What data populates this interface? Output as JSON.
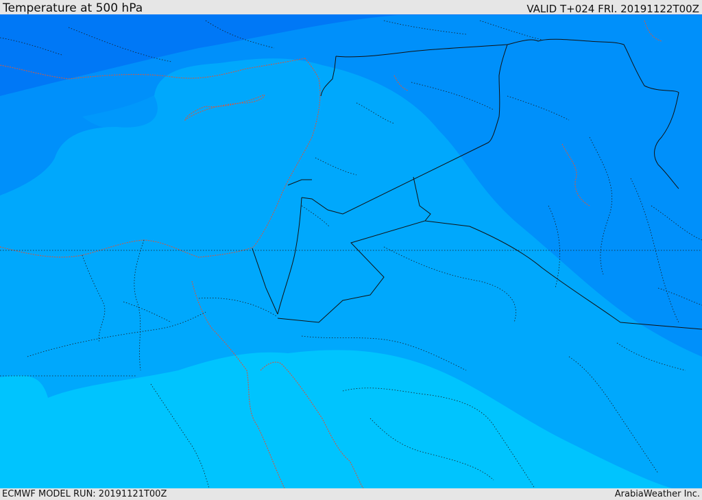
{
  "header": {
    "title": "Temperature at 500 hPa",
    "valid": "VALID T+024 FRI. 20191122T00Z"
  },
  "footer": {
    "model_run": "ECMWF MODEL RUN: 20191121T00Z",
    "credit": "ArabiaWeather Inc."
  },
  "colors": {
    "band_coldest": "#0078f6",
    "band_cold": "#0090fa",
    "band_mid": "#00a8fc",
    "band_warm": "#00c4fe",
    "borders": "#111111",
    "coastline": "#c06050"
  }
}
